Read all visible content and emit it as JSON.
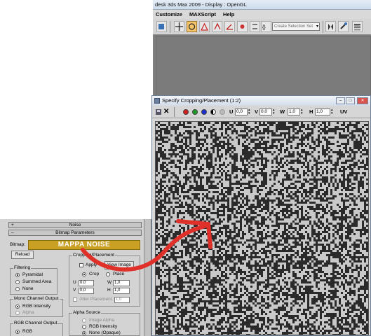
{
  "max_window": {
    "title": "desk 3ds Max 2009      - Display : OpenGL",
    "menu": [
      "Customize",
      "MAXScript",
      "Help"
    ],
    "selection_set_placeholder": "Create Selection Set",
    "toolbar_icons": [
      "select-object-icon",
      "select-and-move-icon",
      "select-and-rotate-icon",
      "select-and-scale-icon",
      "snap-icon",
      "angle-snap-icon",
      "percent-snap-icon",
      "spinner-snap-icon",
      "edit-named-selection-icon",
      "mirror-icon",
      "align-icon",
      "layer-manager-icon"
    ]
  },
  "crop_dialog": {
    "title": "Specify Cropping/Placement (1:2)",
    "channels": [
      {
        "name": "red",
        "color": "#d21c1c"
      },
      {
        "name": "green",
        "color": "#1c9a2a"
      },
      {
        "name": "blue",
        "color": "#1c2fcf"
      }
    ],
    "u_label": "U",
    "u_value": "0,0",
    "v_label": "V",
    "v_value": "0,0",
    "w_label": "W",
    "w_value": "1,0",
    "h_label": "H",
    "h_value": "1,0",
    "uv_label": "UV"
  },
  "material_panel": {
    "noise_rollout": "Noise",
    "bitmap_params_rollout": "Bitmap Parameters",
    "bitmap_label": "Bitmap:",
    "bitmap_value": "MAPPA NOISE",
    "reload_label": "Reload",
    "filtering": {
      "title": "Filtering",
      "options": [
        "Pyramidal",
        "Summed Area",
        "None"
      ],
      "selected": "Pyramidal"
    },
    "mono_output": {
      "title": "Mono Channel Output",
      "options": [
        "RGB Intensity",
        "Alpha"
      ],
      "selected": "RGB Intensity"
    },
    "rgb_output": {
      "title": "RGB Channel Output",
      "options": [
        "RGB"
      ],
      "selected": "RGB"
    },
    "cropping": {
      "title": "Cropping/Placement",
      "apply_label": "Apply",
      "view_image_label": "View Image",
      "crop_label": "Crop",
      "place_label": "Place",
      "selected": "Crop",
      "u_label": "U",
      "u_value": "0,0",
      "v_label": "V",
      "v_value": "0,0",
      "w_label": "W",
      "w_value": "1,0",
      "h_label": "H",
      "h_value": "1,0",
      "jitter_label": "Jitter Placement",
      "jitter_value": "1,0"
    },
    "alpha_source": {
      "title": "Alpha Source",
      "options": [
        "Image Alpha",
        "RGB Intensity",
        "None (Opaque)"
      ],
      "selected": "None (Opaque)"
    }
  },
  "annotation": {
    "arrow_color": "#e0302a"
  }
}
